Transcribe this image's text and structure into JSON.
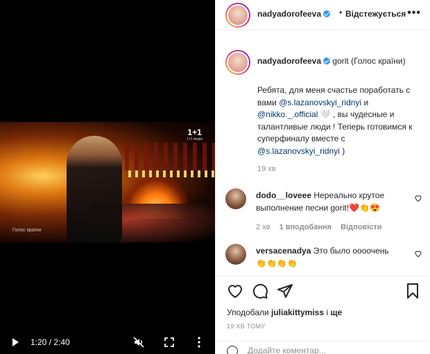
{
  "video": {
    "channel_logo": "1+1",
    "channel_logo_sub": "1+1 медіа",
    "caption_tag": "Голос країни",
    "controls": {
      "play_icon": "play-icon",
      "time": "1:20 / 2:40",
      "mute_icon": "muted-speaker-icon",
      "fullscreen_icon": "fullscreen-icon",
      "more_icon": "vertical-dots-icon"
    }
  },
  "header": {
    "username": "nadyadorofeeva",
    "dot": "•",
    "follow_label": "Відстежується",
    "more_label": "•••"
  },
  "caption": {
    "username": "nadyadorofeeva",
    "location": "gorit (Голос країни)",
    "text_1": "Ребята, для меня счастье поработать с вами ",
    "mention_1": "@s.lazanovskyi_ridnyi",
    "text_2": " и ",
    "mention_2": "@nikko._.official",
    "text_3": " 🤍 , вы чудесные и талантливые люди ! Теперь готовимся к суперфиналу вместе с ",
    "mention_3": "@s.lazanovskyi_ridnyi",
    "text_4": " )",
    "time": "19 хв"
  },
  "comments": [
    {
      "username": "dodo__loveee",
      "text": "Нереально крутое выполнение песни gorit!❤️👏😍",
      "time": "2 хв",
      "likes": "1 вподобання",
      "reply": "Відповісти"
    },
    {
      "username": "versacenadya",
      "text": "Это было оооочень 👏👏👏👏"
    }
  ],
  "actions": {
    "like_icon": "heart-icon",
    "comment_icon": "comment-icon",
    "share_icon": "paper-plane-icon",
    "save_icon": "bookmark-icon"
  },
  "likes": {
    "prefix": "Уподобали ",
    "user": "juliakittymiss",
    "middle": " і ",
    "suffix": "ще"
  },
  "post_time": "19 ХВ ТОМУ",
  "add_comment": {
    "placeholder": "Додайте коментар..."
  },
  "colors": {
    "verified": "#3897f0",
    "mention": "#00376b",
    "muted_text": "#8e8e8e",
    "text": "#262626"
  }
}
